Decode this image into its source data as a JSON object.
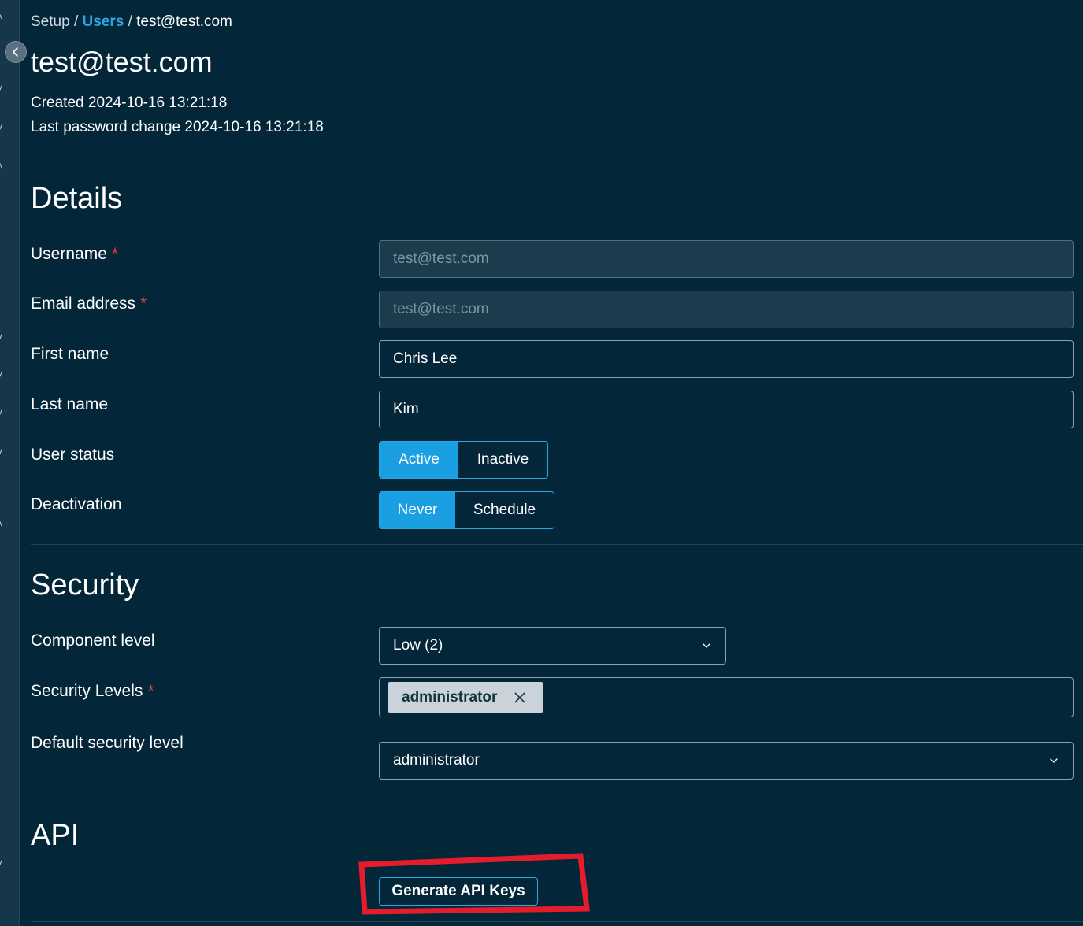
{
  "breadcrumb": {
    "root": "Setup",
    "separator": "/",
    "section": "Users",
    "current": "test@test.com"
  },
  "header": {
    "title": "test@test.com",
    "created": "Created 2024-10-16 13:21:18",
    "last_password_change": "Last password change 2024-10-16 13:21:18"
  },
  "details": {
    "heading": "Details",
    "username": {
      "label": "Username",
      "value": "test@test.com",
      "disabled": true
    },
    "email": {
      "label": "Email address",
      "value": "test@test.com",
      "disabled": true
    },
    "first_name": {
      "label": "First name",
      "value": "Chris Lee"
    },
    "last_name": {
      "label": "Last name",
      "value": "Kim"
    },
    "user_status": {
      "label": "User status",
      "options": [
        "Active",
        "Inactive"
      ],
      "selected": "Active"
    },
    "deactivation": {
      "label": "Deactivation",
      "options": [
        "Never",
        "Schedule"
      ],
      "selected": "Never"
    }
  },
  "security": {
    "heading": "Security",
    "component_level": {
      "label": "Component level",
      "value": "Low (2)"
    },
    "security_levels": {
      "label": "Security Levels",
      "tags": [
        "administrator"
      ]
    },
    "default_security_level": {
      "label": "Default security level",
      "value": "administrator"
    }
  },
  "api": {
    "heading": "API",
    "generate_label": "Generate API Keys"
  },
  "required_marker": "*",
  "colors": {
    "background": "#042639",
    "accent": "#1aa0e2",
    "required": "#e53b3b",
    "annotation": "#e41c2c"
  },
  "icons": {
    "collapse": "chevron-left-icon",
    "dropdown": "chevron-down-icon",
    "remove_tag": "close-icon"
  }
}
